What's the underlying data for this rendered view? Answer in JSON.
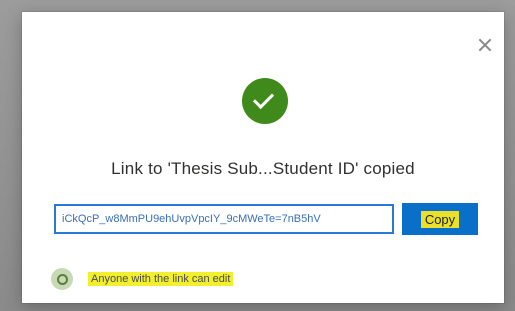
{
  "dialog": {
    "close_icon": "close-icon",
    "status_icon": "checkmark-circle-icon",
    "title": "Link to 'Thesis Sub...Student ID' copied",
    "link_value": "iCkQcP_w8MmPU9ehUvpVpcIY_9cMWeTe=7nB5hV",
    "copy_label": "Copy",
    "permission_icon": "globe-icon",
    "permission_text": "Anyone with the link can edit",
    "colors": {
      "success": "#3f8a1a",
      "accent": "#0a6fc9",
      "highlight": "#f2ef2e"
    }
  }
}
